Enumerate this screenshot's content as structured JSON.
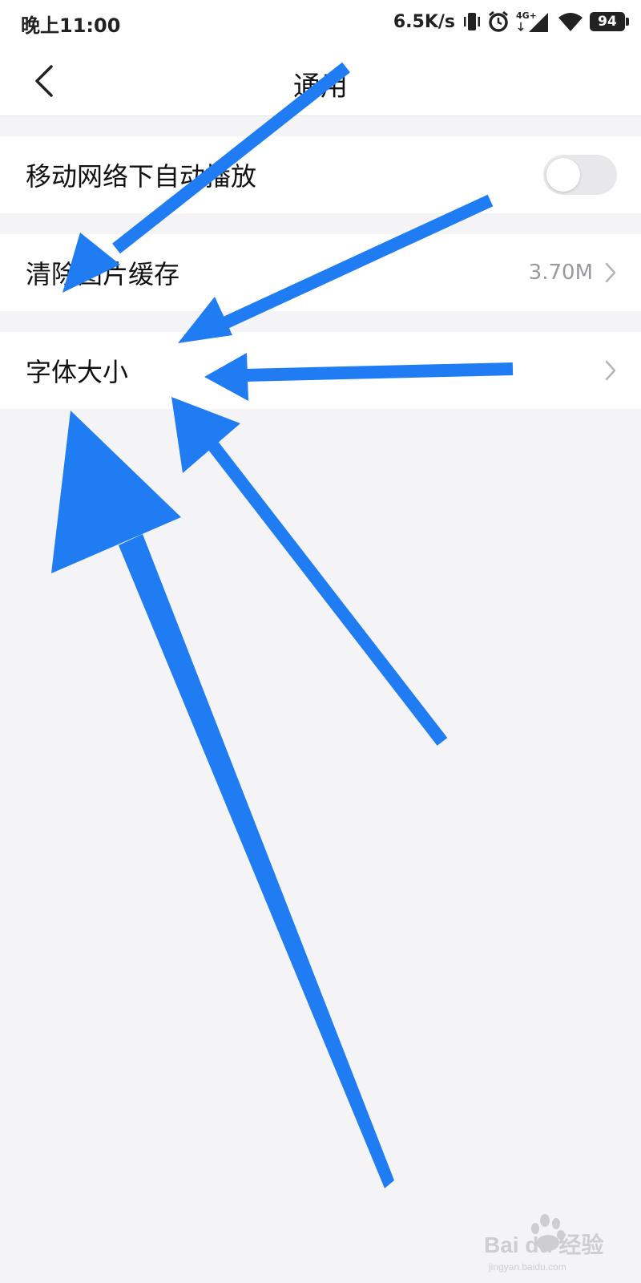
{
  "status_bar": {
    "time": "晚上11:00",
    "network_speed": "6.5K/s",
    "network_type": "4G+",
    "battery_level": "94",
    "icons": [
      "vibrate-icon",
      "alarm-icon",
      "signal-4g-icon",
      "wifi-icon",
      "battery-icon"
    ]
  },
  "header": {
    "title": "通用",
    "back_icon": "back-chevron-icon"
  },
  "settings": {
    "autoplay": {
      "label": "移动网络下自动播放",
      "toggle_on": false
    },
    "clear_cache": {
      "label": "清除图片缓存",
      "value": "3.70M",
      "chevron_icon": "chevron-right-icon"
    },
    "font_size": {
      "label": "字体大小",
      "chevron_icon": "chevron-right-icon"
    }
  },
  "annotation": {
    "arrow_color": "#1f7cf2",
    "arrow_count": 5
  },
  "watermark": {
    "text": "Bai du 经验",
    "sub": "jingyan.baidu.com"
  }
}
